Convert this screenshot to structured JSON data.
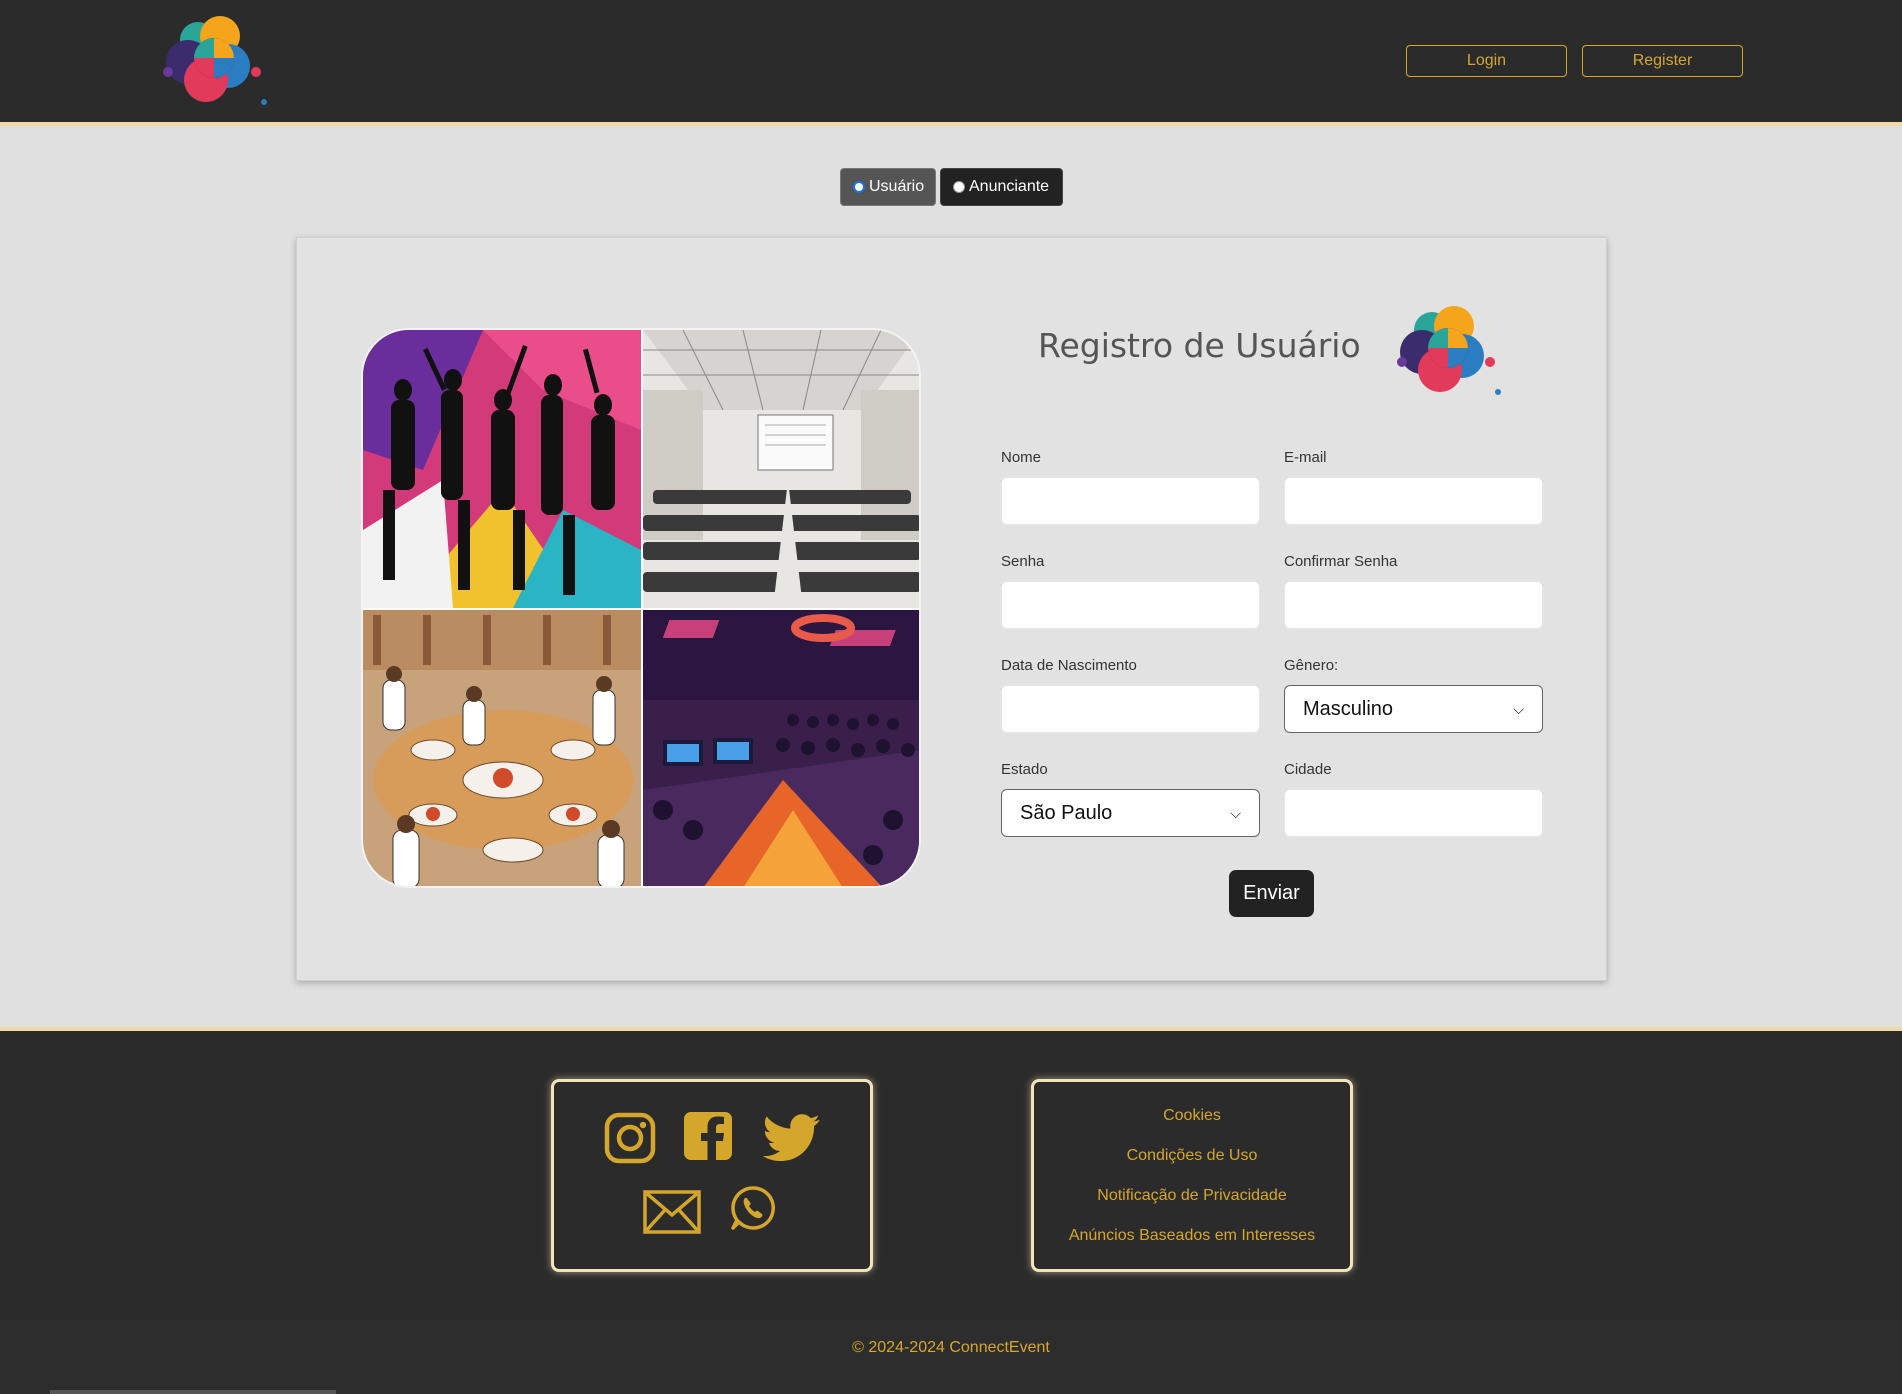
{
  "header": {
    "login_label": "Login",
    "register_label": "Register"
  },
  "toggle": {
    "usuario_label": "Usuário",
    "anunciante_label": "Anunciante",
    "selected": "Usuário"
  },
  "form": {
    "title": "Registro de Usuário",
    "fields": {
      "nome_label": "Nome",
      "email_label": "E-mail",
      "senha_label": "Senha",
      "confirmar_senha_label": "Confirmar Senha",
      "nascimento_label": "Data de Nascimento",
      "genero_label": "Gênero:",
      "genero_value": "Masculino",
      "estado_label": "Estado",
      "estado_value": "São Paulo",
      "cidade_label": "Cidade"
    },
    "submit_label": "Enviar"
  },
  "footer": {
    "social_icons": [
      "instagram-icon",
      "facebook-icon",
      "twitter-icon",
      "mail-icon",
      "whatsapp-icon"
    ],
    "links": [
      "Cookies",
      "Condições de Uso",
      "Notificação de Privacidade",
      "Anúncios Baseados em Interesses"
    ],
    "copyright": "© 2024-2024 ConnectEvent"
  },
  "colors": {
    "accent": "#d4a72c",
    "header_bg": "#2b2b2b",
    "page_bg": "#e0e0e0",
    "border_cream": "#efd9a6"
  }
}
